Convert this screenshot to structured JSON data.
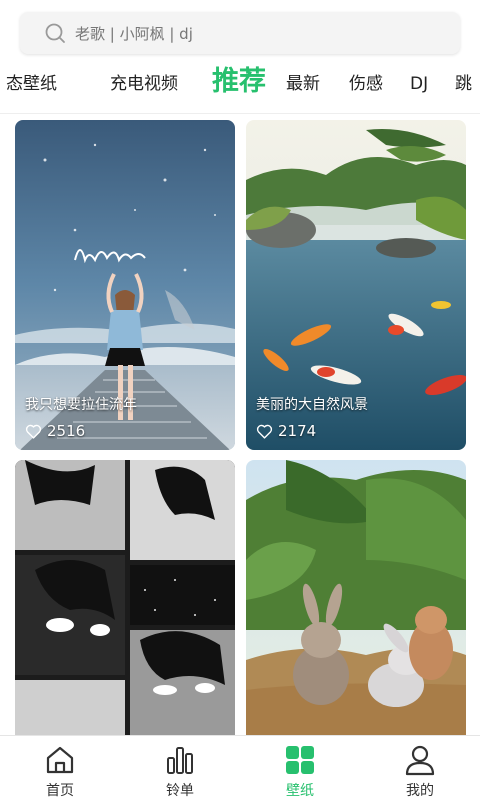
{
  "search": {
    "placeholder": "老歌 | 小阿枫 | dj"
  },
  "tabs": [
    {
      "label": "态壁纸",
      "active": false
    },
    {
      "label": "充电视频",
      "active": false
    },
    {
      "label": "推荐",
      "active": true
    },
    {
      "label": "最新",
      "active": false
    },
    {
      "label": "伤感",
      "active": false
    },
    {
      "label": "DJ",
      "active": false
    },
    {
      "label": "跳",
      "active": false
    }
  ],
  "cards": [
    {
      "title": "我只想要拉住流年",
      "likes": "2516"
    },
    {
      "title": "美丽的大自然风景",
      "likes": "2174"
    },
    {
      "title": "",
      "likes": ""
    },
    {
      "title": "",
      "likes": ""
    }
  ],
  "nav": [
    {
      "label": "首页",
      "icon": "home-icon"
    },
    {
      "label": "铃单",
      "icon": "bar-chart-icon"
    },
    {
      "label": "壁纸",
      "icon": "grid-icon"
    },
    {
      "label": "我的",
      "icon": "user-icon"
    }
  ],
  "colors": {
    "accent": "#27c06e",
    "text": "#222222"
  }
}
